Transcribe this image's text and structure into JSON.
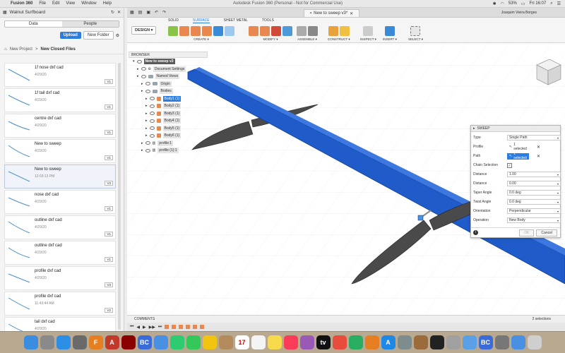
{
  "menubar": {
    "app": "Fusion 360",
    "menus": [
      "File",
      "Edit",
      "View",
      "Window",
      "Help"
    ],
    "window_title": "Autodesk Fusion 360 (Personal - Not for Commercial Use)",
    "battery": "53%",
    "clock": "Fri 16:07"
  },
  "datapanel": {
    "hub": "Walnut Surfboard",
    "tabs": [
      "Data",
      "People"
    ],
    "upload": "Upload",
    "new_folder": "New Folder",
    "breadcrumb": [
      "New Project",
      "New Closed Files"
    ],
    "files": [
      {
        "name": "1f nose dxf cad",
        "date": "4/29/20",
        "ver": "V1"
      },
      {
        "name": "1f tail dxf cad",
        "date": "4/29/20",
        "ver": "V1"
      },
      {
        "name": "centre dxf cad",
        "date": "4/29/20",
        "ver": "V1"
      },
      {
        "name": "New to sweep",
        "date": "4/29/20",
        "ver": "V1"
      },
      {
        "name": "New to sweep",
        "date": "12:03:13 PM",
        "ver": "V3"
      },
      {
        "name": "nose dxf cad",
        "date": "4/29/20",
        "ver": "V1"
      },
      {
        "name": "outline dxf cad",
        "date": "4/29/20",
        "ver": "V1"
      },
      {
        "name": "outline dxf cad",
        "date": "4/29/20",
        "ver": "V1"
      },
      {
        "name": "profile dxf cad",
        "date": "4/29/20",
        "ver": "V3"
      },
      {
        "name": "profile dxf cad",
        "date": "11:43:44 AM",
        "ver": "V2"
      },
      {
        "name": "tail dxf cad",
        "date": "4/29/20",
        "ver": "V1"
      }
    ]
  },
  "document": {
    "tab_title": "New to sweep v3*",
    "user": "Joaquim Vieira Borges"
  },
  "toolbar": {
    "workspace": "DESIGN",
    "tabs": [
      "SOLID",
      "SURFACE",
      "SHEET METAL",
      "TOOLS"
    ],
    "groups": [
      "CREATE",
      "MODIFY",
      "ASSEMBLE",
      "CONSTRUCT",
      "INSPECT",
      "INSERT",
      "SELECT"
    ]
  },
  "browser": {
    "title": "BROWSER",
    "root": "New to sweep v3",
    "items": [
      {
        "label": "Document Settings",
        "kind": "gear",
        "indent": 1
      },
      {
        "label": "Named Views",
        "kind": "folder",
        "indent": 1
      },
      {
        "label": "Origin",
        "kind": "folder",
        "indent": 2
      },
      {
        "label": "Bodies",
        "kind": "folder",
        "indent": 2
      },
      {
        "label": "Body1 (1)",
        "kind": "body",
        "indent": 3,
        "selected": true
      },
      {
        "label": "Body2 (1)",
        "kind": "body",
        "indent": 3
      },
      {
        "label": "Body3 (1)",
        "kind": "body",
        "indent": 3
      },
      {
        "label": "Body4 (1)",
        "kind": "body",
        "indent": 3
      },
      {
        "label": "Body5 (1)",
        "kind": "body",
        "indent": 3
      },
      {
        "label": "Body6 (1)",
        "kind": "body",
        "indent": 3
      },
      {
        "label": "profile:1",
        "kind": "comp",
        "indent": 2
      },
      {
        "label": "profile (1):1",
        "kind": "comp",
        "indent": 2
      }
    ]
  },
  "sweep": {
    "title": "SWEEP",
    "type_label": "Type",
    "type_value": "Single Path",
    "profile_label": "Profile",
    "profile_value": "1 selected",
    "path_label": "Path",
    "path_value": "1 selected",
    "chain_label": "Chain Selection",
    "distance1_label": "Distance",
    "distance1_value": "1.00",
    "distance2_label": "Distance",
    "distance2_value": "0.00",
    "taper_label": "Taper Angle",
    "taper_value": "0.0 deg",
    "twist_label": "Twist Angle",
    "twist_value": "0.0 deg",
    "orientation_label": "Orientation",
    "orientation_value": "Perpendicular",
    "operation_label": "Operation",
    "operation_value": "New Body",
    "ok": "OK",
    "cancel": "Cancel"
  },
  "bottom": {
    "comments": "COMMENTS",
    "selections": "2 selections"
  },
  "colors": {
    "accent": "#2b7de1",
    "beam": "#1f5bc9",
    "fin": "#4a4a4a",
    "dock": "#b9a991"
  },
  "dock": [
    {
      "name": "finder-icon",
      "color": "#3b8de0",
      "glyph": ""
    },
    {
      "name": "launchpad-icon",
      "color": "#8a8a8a",
      "glyph": ""
    },
    {
      "name": "safari-icon",
      "color": "#2d8ee6",
      "glyph": ""
    },
    {
      "name": "rocket-icon",
      "color": "#6a6a6a",
      "glyph": ""
    },
    {
      "name": "fusion-icon",
      "color": "#e67e22",
      "glyph": "F"
    },
    {
      "name": "acrobat-icon",
      "color": "#c0392b",
      "glyph": "A"
    },
    {
      "name": "app-icon",
      "color": "#8b0000",
      "glyph": ""
    },
    {
      "name": "text-icon",
      "color": "#3a6bd8",
      "glyph": "BC"
    },
    {
      "name": "mail-icon",
      "color": "#4a90e2",
      "glyph": ""
    },
    {
      "name": "facetime-icon",
      "color": "#2ecc71",
      "glyph": ""
    },
    {
      "name": "messages-icon",
      "color": "#34c759",
      "glyph": ""
    },
    {
      "name": "photos-icon",
      "color": "#f1c40f",
      "glyph": ""
    },
    {
      "name": "contacts-icon",
      "color": "#b38b5d",
      "glyph": ""
    },
    {
      "name": "calendar-icon",
      "color": "#ffffff",
      "glyph": "17"
    },
    {
      "name": "reminders-icon",
      "color": "#f4f4f4",
      "glyph": ""
    },
    {
      "name": "notes-icon",
      "color": "#f7d94c",
      "glyph": ""
    },
    {
      "name": "music-icon",
      "color": "#fa3b5a",
      "glyph": ""
    },
    {
      "name": "podcasts-icon",
      "color": "#9b59b6",
      "glyph": ""
    },
    {
      "name": "tv-icon",
      "color": "#111111",
      "glyph": "tv"
    },
    {
      "name": "news-icon",
      "color": "#e74c3c",
      "glyph": ""
    },
    {
      "name": "numbers-icon",
      "color": "#27ae60",
      "glyph": ""
    },
    {
      "name": "pages-icon",
      "color": "#e67e22",
      "glyph": ""
    },
    {
      "name": "appstore-icon",
      "color": "#1e88e5",
      "glyph": "A"
    },
    {
      "name": "settings-icon",
      "color": "#7f8c8d",
      "glyph": ""
    },
    {
      "name": "preview-icon",
      "color": "#9c6b3b",
      "glyph": ""
    },
    {
      "name": "activity-icon",
      "color": "#222222",
      "glyph": ""
    },
    {
      "name": "image-icon",
      "color": "#a0a0a0",
      "glyph": ""
    },
    {
      "name": "folder-icon",
      "color": "#5aa0e6",
      "glyph": ""
    },
    {
      "name": "text2-icon",
      "color": "#3a6bd8",
      "glyph": "BC"
    },
    {
      "name": "photo-icon",
      "color": "#777777",
      "glyph": ""
    },
    {
      "name": "downloads-icon",
      "color": "#4a90e2",
      "glyph": ""
    },
    {
      "name": "trash-icon",
      "color": "#cfcfcf",
      "glyph": ""
    }
  ]
}
